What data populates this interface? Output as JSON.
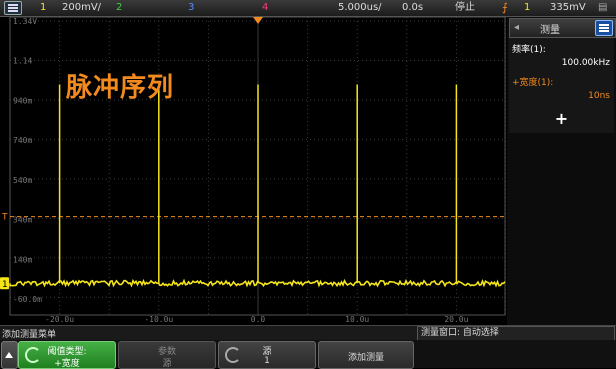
{
  "topbar": {
    "ch1_num": "1",
    "ch1_scale": "200mV/",
    "ch2_num": "2",
    "ch3_num": "3",
    "ch4_num": "4",
    "timebase": "5.000us/",
    "delay": "0.0s",
    "run_state": "停止",
    "trig_channel": "1",
    "trig_level": "335mV"
  },
  "scope": {
    "title": "脉冲序列",
    "y_labels": [
      "1.34V",
      "1.14",
      "940m",
      "740m",
      "540m",
      "340m",
      "140m",
      "-60.0m"
    ],
    "x_labels": [
      "-20.0u",
      "-10.0u",
      "0.0",
      "10.0u",
      "20.0u"
    ],
    "ch1_marker": "1",
    "trig_marker": "T"
  },
  "panel": {
    "title": "测量",
    "m1_label": "频率(1):",
    "m1_value": "100.00kHz",
    "m2_label": "+宽度(1):",
    "m2_value": "10ns",
    "add_symbol": "+"
  },
  "msgbar": {
    "left": "添加测量菜单",
    "right": "测量窗口: 自动选择"
  },
  "softkeys": {
    "sk1_line1": "阈值类型:",
    "sk1_line2": "+宽度",
    "sk2_line1": "参数",
    "sk2_line2": "源",
    "sk3_line1": "源",
    "sk3_line2": "1",
    "sk4_line1": "添加测量"
  },
  "chart_data": {
    "type": "line",
    "title": "脉冲序列",
    "x_unit": "us",
    "y_unit": "V",
    "xlim": [
      -25,
      25
    ],
    "ylim": [
      -0.16,
      1.34
    ],
    "baseline": 0.0,
    "pulse_peak": 1.0,
    "pulse_times_us": [
      -20,
      -10,
      0,
      10,
      20
    ],
    "trigger_level": 0.335,
    "colors": {
      "ch1": "#f5e61a",
      "trigger": "#f28a1f",
      "grid": "#3a3a3a",
      "accent": "#2b70d6"
    }
  }
}
